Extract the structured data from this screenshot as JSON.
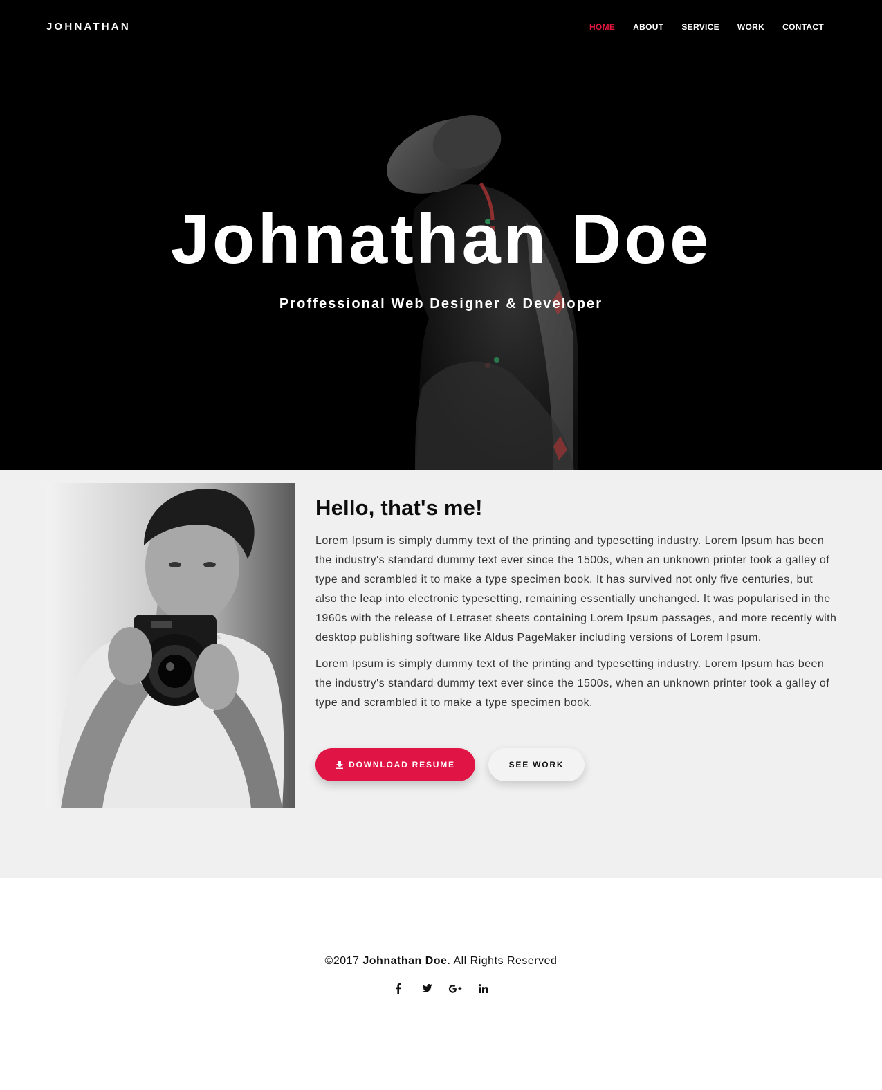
{
  "nav": {
    "brand": "JOHNATHAN",
    "items": [
      {
        "label": "HOME",
        "active": true
      },
      {
        "label": "ABOUT",
        "active": false
      },
      {
        "label": "SERVICE",
        "active": false
      },
      {
        "label": "WORK",
        "active": false
      },
      {
        "label": "CONTACT",
        "active": false
      }
    ]
  },
  "hero": {
    "title": "Johnathan Doe",
    "subtitle": "Proffessional Web Designer & Developer"
  },
  "about": {
    "heading": "Hello, that's me!",
    "paragraphs": [
      "Lorem Ipsum is simply dummy text of the printing and typesetting industry. Lorem Ipsum has been the industry's standard dummy text ever since the 1500s, when an unknown printer took a galley of type and scrambled it to make a type specimen book. It has survived not only five centuries, but also the leap into electronic typesetting, remaining essentially unchanged. It was popularised in the 1960s with the release of Letraset sheets containing Lorem Ipsum passages, and more recently with desktop publishing software like Aldus PageMaker including versions of Lorem Ipsum.",
      "Lorem Ipsum is simply dummy text of the printing and typesetting industry. Lorem Ipsum has been the industry's standard dummy text ever since the 1500s, when an unknown printer took a galley of type and scrambled it to make a type specimen book."
    ],
    "download_label": "DOWNLOAD RESUME",
    "download_icon": "download-icon",
    "see_work_label": "SEE WORK"
  },
  "footer": {
    "copyright_prefix": "©2017 ",
    "copyright_name": "Johnathan Doe",
    "copyright_suffix": ". All Rights Reserved",
    "social": [
      {
        "icon": "facebook-icon",
        "glyph": "f"
      },
      {
        "icon": "twitter-icon",
        "glyph": "t"
      },
      {
        "icon": "google-plus-icon",
        "glyph": "G+"
      },
      {
        "icon": "linkedin-icon",
        "glyph": "in"
      }
    ]
  },
  "colors": {
    "accent": "#e01545",
    "hero_bg": "#000000",
    "about_bg": "#f0f0f0"
  }
}
